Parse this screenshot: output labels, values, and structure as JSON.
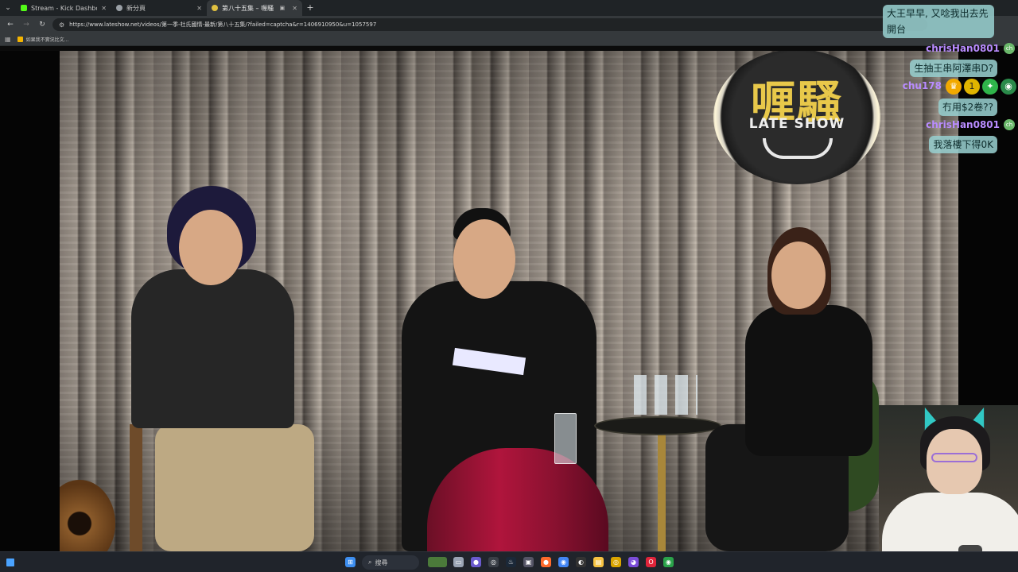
{
  "browser": {
    "tabs": [
      {
        "title": "Stream - Kick Dashboard",
        "favicon_color": "#53fc18",
        "active": false
      },
      {
        "title": "新分頁",
        "favicon_color": "#9aa0a6",
        "active": false
      },
      {
        "title": "第八十五集 – 喱騷",
        "favicon_color": "#e0c040",
        "active": true
      }
    ],
    "url": "https://www.lateshow.net/videos/第一季-杜氏國情-最新/第八十五集/?failed=captcha&r=1406910950&u=1057597",
    "bookmark": "如果我不實況比文..."
  },
  "video": {
    "logo_main": "喱騷",
    "logo_sub": "LATE SHOW"
  },
  "chat": {
    "messages": [
      {
        "text": "大王早早, 又唸我出去先開台"
      },
      {
        "user": "chrisHan0801",
        "badge": "ch"
      },
      {
        "text": "生抽王串阿澤串D?"
      },
      {
        "user": "chu178"
      },
      {
        "text": "冇用$2卷??"
      },
      {
        "user": "chrisHan0801",
        "badge": "ch"
      },
      {
        "text": "我落樓下得0K"
      }
    ]
  },
  "taskbar": {
    "search_label": "搜尋"
  },
  "colors": {
    "chat_bubble": "#96cdcd",
    "username": "#b98cff",
    "taskbar": "#20242b"
  }
}
